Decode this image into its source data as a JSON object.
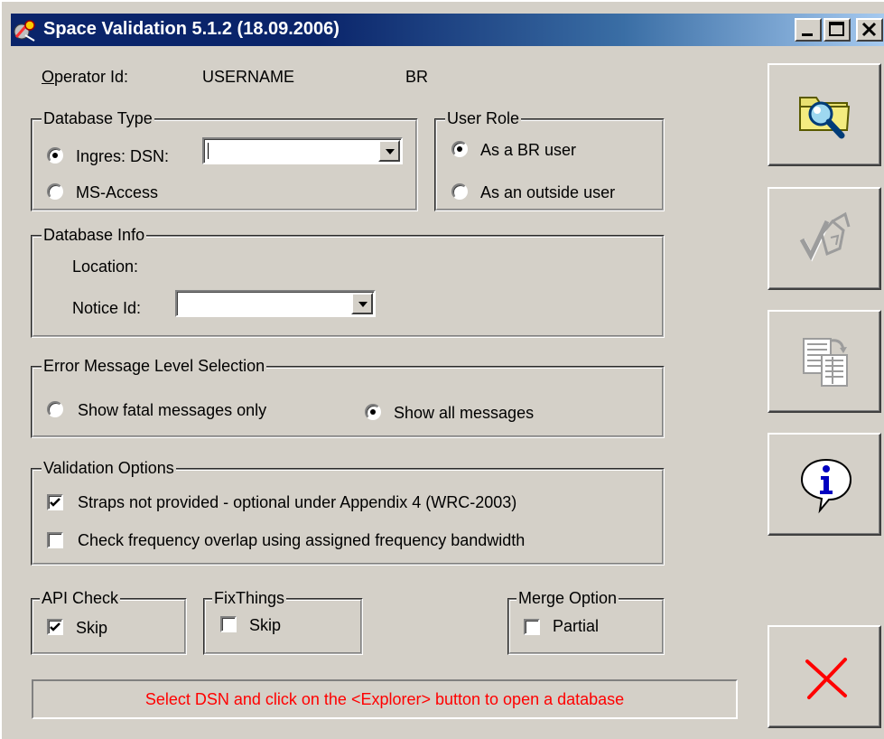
{
  "window": {
    "title": "Space Validation 5.1.2 (18.09.2006)"
  },
  "operator": {
    "label_prefix": "O",
    "label_rest": "perator Id:",
    "username": "USERNAME",
    "role_code": "BR"
  },
  "database_type": {
    "legend": "Database Type",
    "options": [
      {
        "label": "Ingres: DSN:",
        "selected": true
      },
      {
        "label": "MS-Access",
        "selected": false
      }
    ],
    "dsn_value": ""
  },
  "user_role": {
    "legend": "User Role",
    "options": [
      {
        "label": "As a BR user",
        "selected": true
      },
      {
        "label": "As an outside user",
        "selected": false
      }
    ]
  },
  "database_info": {
    "legend": "Database Info",
    "location_label": "Location:",
    "notice_label": "Notice Id:",
    "notice_value": ""
  },
  "error_level": {
    "legend": "Error Message Level Selection",
    "options": [
      {
        "label": "Show fatal messages only",
        "selected": false
      },
      {
        "label": "Show all messages",
        "selected": true
      }
    ]
  },
  "validation_options": {
    "legend": "Validation Options",
    "options": [
      {
        "label": "Straps not provided - optional under Appendix 4 (WRC-2003)",
        "checked": true
      },
      {
        "label": "Check frequency overlap using assigned frequency bandwidth",
        "checked": false
      }
    ]
  },
  "api_check": {
    "legend": "API Check",
    "option_label": "Skip",
    "checked": true
  },
  "fix_things": {
    "legend": "FixThings",
    "option_label": "Skip",
    "checked": false
  },
  "merge_option": {
    "legend": "Merge Option",
    "option_label": "Partial",
    "checked": false
  },
  "status": {
    "message": "Select DSN and click on the <Explorer> button to open a database",
    "color": "#ff0000"
  },
  "toolbar": {
    "buttons": [
      {
        "icon": "folder-search-icon",
        "enabled": true
      },
      {
        "icon": "validate-icon",
        "enabled": false
      },
      {
        "icon": "report-icon",
        "enabled": false
      },
      {
        "icon": "info-icon",
        "enabled": true
      },
      {
        "icon": "exit-icon",
        "enabled": true
      }
    ]
  },
  "colors": {
    "titlebar": "#0a246a",
    "face": "#d4d0c8",
    "accent_red": "#ff0000"
  }
}
